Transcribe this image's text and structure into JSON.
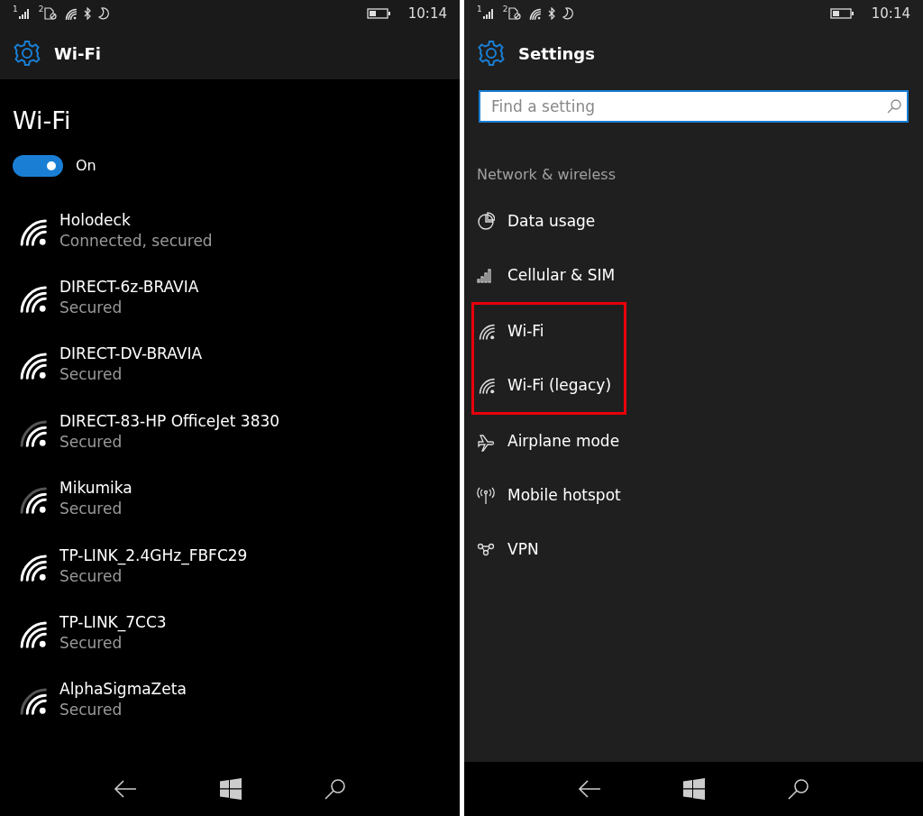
{
  "left_screen": {
    "status_bar": {
      "sim1": "1",
      "sim2": "2",
      "time": "10:14"
    },
    "header": {
      "title": "Wi-Fi"
    },
    "page_title": "Wi-Fi",
    "toggle": {
      "on": true,
      "label": "On"
    },
    "networks": [
      {
        "name": "Holodeck",
        "status": "Connected, secured",
        "kind": "strong"
      },
      {
        "name": "DIRECT-6z-BRAVIA",
        "status": "Secured",
        "kind": "strong"
      },
      {
        "name": "DIRECT-DV-BRAVIA",
        "status": "Secured",
        "kind": "strong"
      },
      {
        "name": "DIRECT-83-HP OfficeJet 3830",
        "status": "Secured",
        "kind": "medium"
      },
      {
        "name": "Mikumika",
        "status": "Secured",
        "kind": "medium"
      },
      {
        "name": "TP-LINK_2.4GHz_FBFC29",
        "status": "Secured",
        "kind": "strong"
      },
      {
        "name": "TP-LINK_7CC3",
        "status": "Secured",
        "kind": "strong"
      },
      {
        "name": "AlphaSigmaZeta",
        "status": "Secured",
        "kind": "medium"
      }
    ]
  },
  "right_screen": {
    "status_bar": {
      "sim1": "1",
      "sim2": "2",
      "time": "10:14"
    },
    "header": {
      "title": "Settings"
    },
    "search": {
      "placeholder": "Find a setting"
    },
    "section_title": "Network & wireless",
    "items": [
      {
        "label": "Data usage",
        "kind": "data",
        "highlighted": false
      },
      {
        "label": "Cellular & SIM",
        "kind": "cellular",
        "highlighted": false
      },
      {
        "label": "Wi-Fi",
        "kind": "wifi",
        "highlighted": true
      },
      {
        "label": "Wi-Fi (legacy)",
        "kind": "wifi",
        "highlighted": true
      },
      {
        "label": "Airplane mode",
        "kind": "airplane",
        "highlighted": false
      },
      {
        "label": "Mobile hotspot",
        "kind": "hotspot",
        "highlighted": false
      },
      {
        "label": "VPN",
        "kind": "vpn",
        "highlighted": false
      }
    ]
  }
}
